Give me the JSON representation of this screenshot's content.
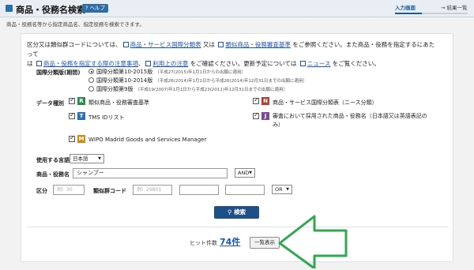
{
  "header": {
    "title": "商品・役務名検索",
    "help_label": "ヘルプ",
    "step_input": "入力画面",
    "step_result": "→ 結果一覧"
  },
  "subtitle": "商品・役務名等から指定商品名、指定役務を検索できます。",
  "intro": {
    "t1": "区分又は類似群コードについては、",
    "link1": "商品・サービス国際分類表",
    "t2": " 又は ",
    "link2": "類似商品・役務審査基準",
    "t3": " をご参照ください。また商品・役務を指定するにあたって",
    "t4": "は ",
    "link3": "商品・役務を指定する際の注意事項",
    "t5": "、",
    "link4": "利用上の注意",
    "t6": " をご確認ください。更新予定については ",
    "link5": "ニュース",
    "t7": " をご覧ください。"
  },
  "period": {
    "label": "国際分類版(期間)",
    "options": [
      {
        "label": "国際分類第10-2015版",
        "note": "（平成27(2015)年1月1日からの出願に適用）",
        "selected": true
      },
      {
        "label": "国際分類第10-2014版",
        "note": "（平成26(2014)年1月1日から平成26(2014)年12月31日までの出願に適用）",
        "selected": false
      },
      {
        "label": "国際分類第9版",
        "note": "（平成19(2007)年1月1日から平成23(2011)年12月31日までの出願に適用）",
        "selected": false
      }
    ]
  },
  "data_types": {
    "label": "データ種別",
    "items": [
      {
        "code": "R",
        "label": "類似商品・役務審査基準",
        "color": "#2a8a4a"
      },
      {
        "code": "N",
        "label": "商品・サービス国際分類表（ニース分類）",
        "color": "#c0392b"
      },
      {
        "code": "T",
        "label": "TMS IDリスト",
        "color": "#2a6fb0"
      },
      {
        "code": "J",
        "label": "審査において採用された商品・役務名（日本語又は英語表記のみ）",
        "color": "#7b4a9a"
      },
      {
        "code": "M",
        "label": "WIPO Madrid Goods and Services Manager",
        "color": "#d08a10"
      }
    ]
  },
  "language": {
    "label": "使用する言語",
    "value": "日本語"
  },
  "goods": {
    "label": "商品・役務名",
    "value": "シャンプー",
    "operator": "AND"
  },
  "class_row": {
    "class_label": "区分",
    "class_placeholder": "例）30",
    "code_label": "類似群コード",
    "code_placeholder": "例）29B01",
    "operator": "OR"
  },
  "search_button": "検索",
  "result": {
    "hits_label": "ヒット件数",
    "count": "74件",
    "list_button": "一覧表示"
  },
  "colors": {
    "accent": "#1f4f88",
    "link": "#1a55b8",
    "arrow": "#2fa84f"
  }
}
